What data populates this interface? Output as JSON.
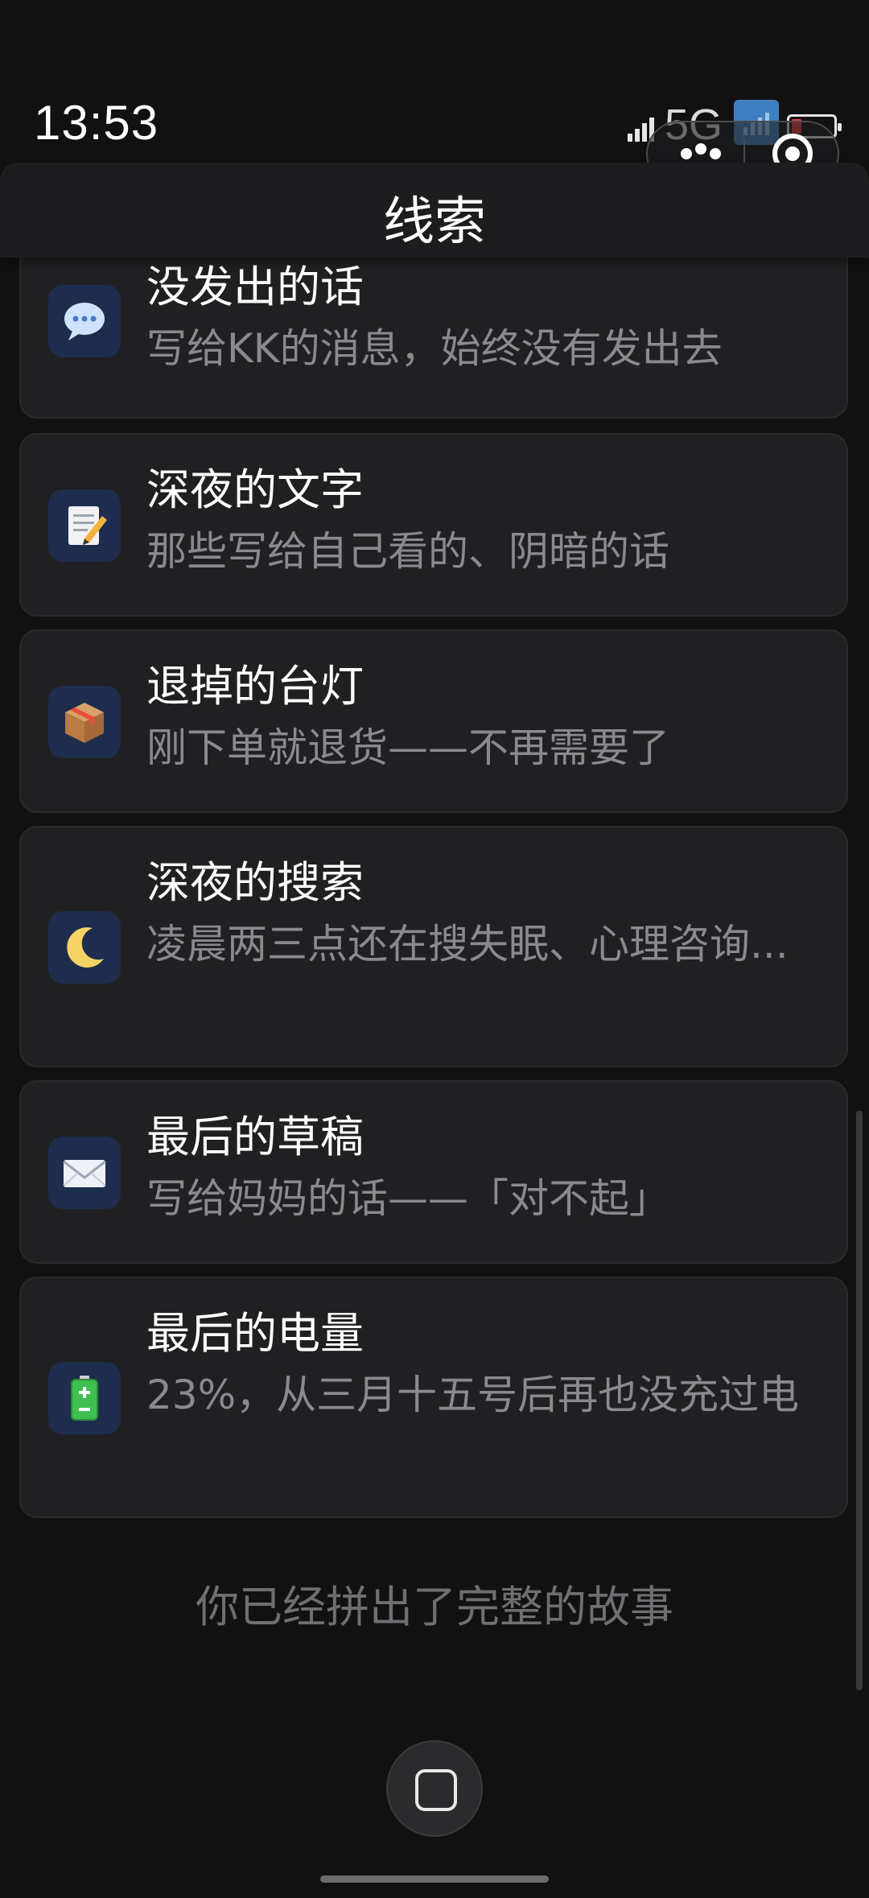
{
  "status_bar": {
    "time": "13:53",
    "network": "5G"
  },
  "header": {
    "title": "线索"
  },
  "clues": [
    {
      "icon": "speech-bubble-icon",
      "title": "没发出的话",
      "desc": "写给KK的消息，始终没有发出去"
    },
    {
      "icon": "memo-icon",
      "title": "深夜的文字",
      "desc": "那些写给自己看的、阴暗的话"
    },
    {
      "icon": "package-icon",
      "title": "退掉的台灯",
      "desc": "刚下单就退货——不再需要了"
    },
    {
      "icon": "crescent-moon-icon",
      "title": "深夜的搜索",
      "desc": "凌晨两三点还在搜失眠、心理咨询..."
    },
    {
      "icon": "envelope-icon",
      "title": "最后的草稿",
      "desc": "写给妈妈的话——「对不起」"
    },
    {
      "icon": "battery-icon",
      "title": "最后的电量",
      "desc": "23%，从三月十五号后再也没充过电"
    }
  ],
  "footer": {
    "note": "你已经拼出了完整的故事"
  },
  "colors": {
    "background": "#111112",
    "card": "#202022",
    "icon_tile": "#1e2d4d",
    "muted_text": "#8a8a8e"
  }
}
